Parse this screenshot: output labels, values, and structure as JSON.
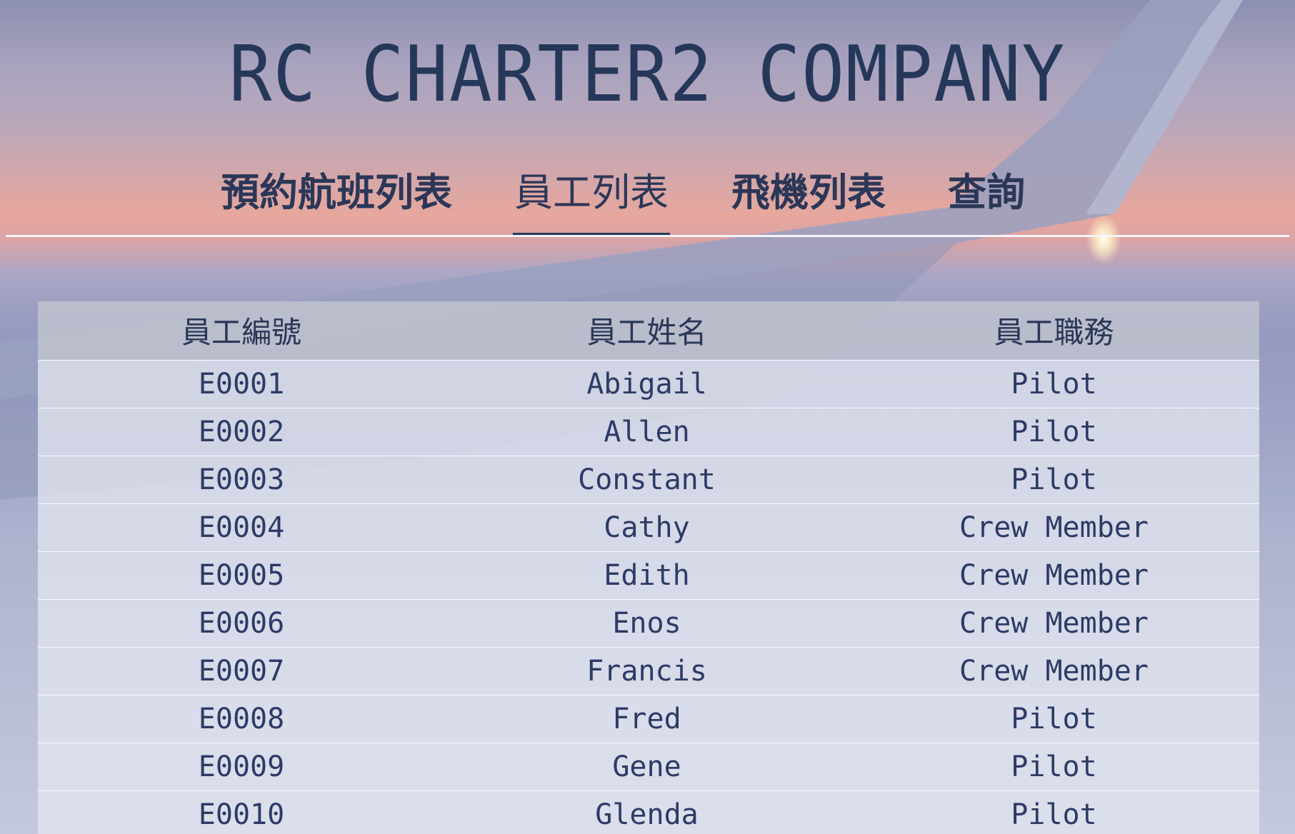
{
  "header": {
    "title": "RC CHARTER2 COMPANY"
  },
  "nav": {
    "tabs": [
      {
        "label": "預約航班列表",
        "active": false
      },
      {
        "label": "員工列表",
        "active": true
      },
      {
        "label": "飛機列表",
        "active": false
      },
      {
        "label": "查詢",
        "active": false
      }
    ]
  },
  "table": {
    "headers": [
      "員工編號",
      "員工姓名",
      "員工職務"
    ],
    "rows": [
      [
        "E0001",
        "Abigail",
        "Pilot"
      ],
      [
        "E0002",
        "Allen",
        "Pilot"
      ],
      [
        "E0003",
        "Constant",
        "Pilot"
      ],
      [
        "E0004",
        "Cathy",
        "Crew Member"
      ],
      [
        "E0005",
        "Edith",
        "Crew Member"
      ],
      [
        "E0006",
        "Enos",
        "Crew Member"
      ],
      [
        "E0007",
        "Francis",
        "Crew Member"
      ],
      [
        "E0008",
        "Fred",
        "Pilot"
      ],
      [
        "E0009",
        "Gene",
        "Pilot"
      ],
      [
        "E0010",
        "Glenda",
        "Pilot"
      ]
    ]
  },
  "colors": {
    "title": "#26385a",
    "nav_text": "#2b3757",
    "cell_text": "#2c3b66"
  }
}
